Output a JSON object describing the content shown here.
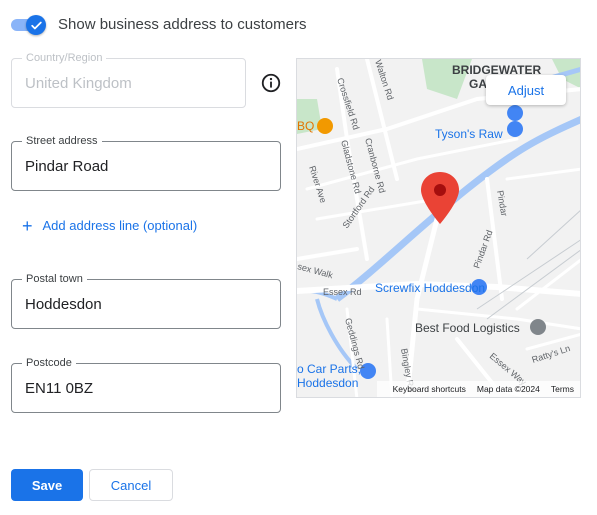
{
  "toggle": {
    "label": "Show business address to customers",
    "checked": true
  },
  "fields": {
    "country": {
      "label": "Country/Region",
      "value": "United Kingdom",
      "disabled": true
    },
    "street": {
      "label": "Street address",
      "value": "Pindar Road"
    },
    "town": {
      "label": "Postal town",
      "value": "Hoddesdon"
    },
    "postcode": {
      "label": "Postcode",
      "value": "EN11 0BZ"
    }
  },
  "add_line": {
    "label": "Add address line (optional)",
    "icon": "plus-icon"
  },
  "map": {
    "adjust_label": "Adjust",
    "labels": {
      "area": "BRIDGEWATER",
      "area2": "GA",
      "tysons": "Tyson's Raw",
      "screwfix": "Screwfix Hoddesdon",
      "bestfood": "Best Food Logistics",
      "carparts1": "o Car Parts,",
      "carparts2": "Hoddesdon",
      "bbq": "BQ",
      "crossfield": "Crossfield Rd",
      "walton": "Walton Rd",
      "gladstone": "Gladstone Rd",
      "cranborne": "Cranborne Rd",
      "river": "River Ave",
      "stortford": "Stortford Rd",
      "pindar1": "Pindar",
      "pindar2": "Pindar Rd",
      "essexrd": "Essex Rd",
      "essexwalk": "sex Walk",
      "geddings": "Geddings Rd",
      "bingley": "Bingley Rd",
      "essexway": "Essex Way",
      "rattys": "Ratty's Ln"
    },
    "footer": {
      "shortcuts": "Keyboard shortcuts",
      "mapdata": "Map data ©2024",
      "terms": "Terms"
    },
    "colors": {
      "water": "#a5c7f7",
      "park": "#c8e6c9",
      "pin": "#ea4335",
      "poi": "#4285f4"
    }
  },
  "buttons": {
    "save": "Save",
    "cancel": "Cancel"
  },
  "colors": {
    "accent": "#1a73e8"
  }
}
